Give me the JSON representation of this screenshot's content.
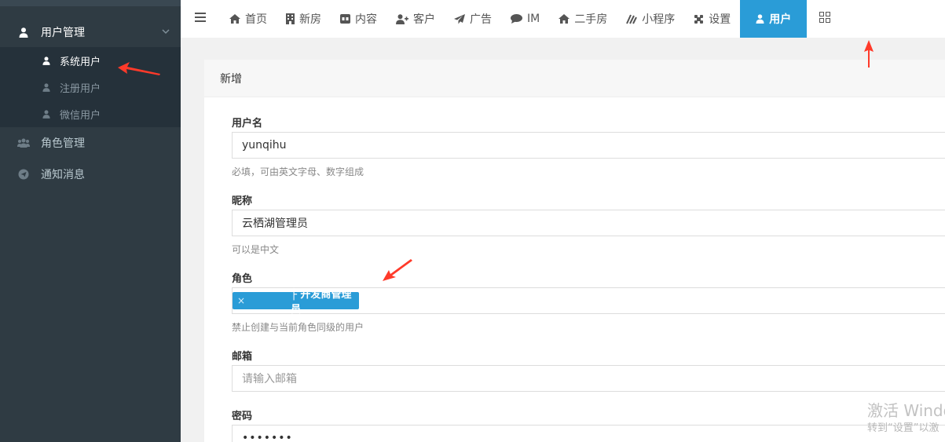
{
  "sidebar": {
    "group": {
      "label": "用户管理",
      "icon": "user-icon"
    },
    "sub_items": [
      {
        "label": "系统用户",
        "icon": "user-icon",
        "active": true
      },
      {
        "label": "注册用户",
        "icon": "user-icon",
        "active": false
      },
      {
        "label": "微信用户",
        "icon": "user-icon",
        "active": false
      }
    ],
    "items": [
      {
        "label": "角色管理",
        "icon": "users-icon"
      },
      {
        "label": "通知消息",
        "icon": "send-circle-icon"
      }
    ]
  },
  "topnav": {
    "items": [
      {
        "label": "首页",
        "icon": "home-icon"
      },
      {
        "label": "新房",
        "icon": "building-icon"
      },
      {
        "label": "内容",
        "icon": "content-icon"
      },
      {
        "label": "客户",
        "icon": "user-plus-icon"
      },
      {
        "label": "广告",
        "icon": "paper-plane-icon"
      },
      {
        "label": "IM",
        "icon": "chat-icon"
      },
      {
        "label": "二手房",
        "icon": "home-icon"
      },
      {
        "label": "小程序",
        "icon": "miniapp-icon"
      },
      {
        "label": "设置",
        "icon": "joomla-icon"
      },
      {
        "label": "用户",
        "icon": "user-icon",
        "active": true
      }
    ]
  },
  "panel": {
    "title": "新增",
    "username": {
      "label": "用户名",
      "value": "yunqihu",
      "help": "必填，可由英文字母、数字组成"
    },
    "nickname": {
      "label": "昵称",
      "value": "云栖湖管理员",
      "help": "可以是中文"
    },
    "role": {
      "label": "角色",
      "tag_remove": "×",
      "tag": "├ 开发商管理员",
      "help": "禁止创建与当前角色同级的用户"
    },
    "email": {
      "label": "邮箱",
      "placeholder": "请输入邮箱"
    },
    "password": {
      "label": "密码",
      "value": "•••••••"
    }
  },
  "watermark": {
    "line1": "激活 Windo",
    "line2": "转到“设置”以激"
  },
  "colors": {
    "accent": "#2a9cd7",
    "sidebar_bg": "#2f3b43",
    "arrow": "#ff3a2a"
  }
}
